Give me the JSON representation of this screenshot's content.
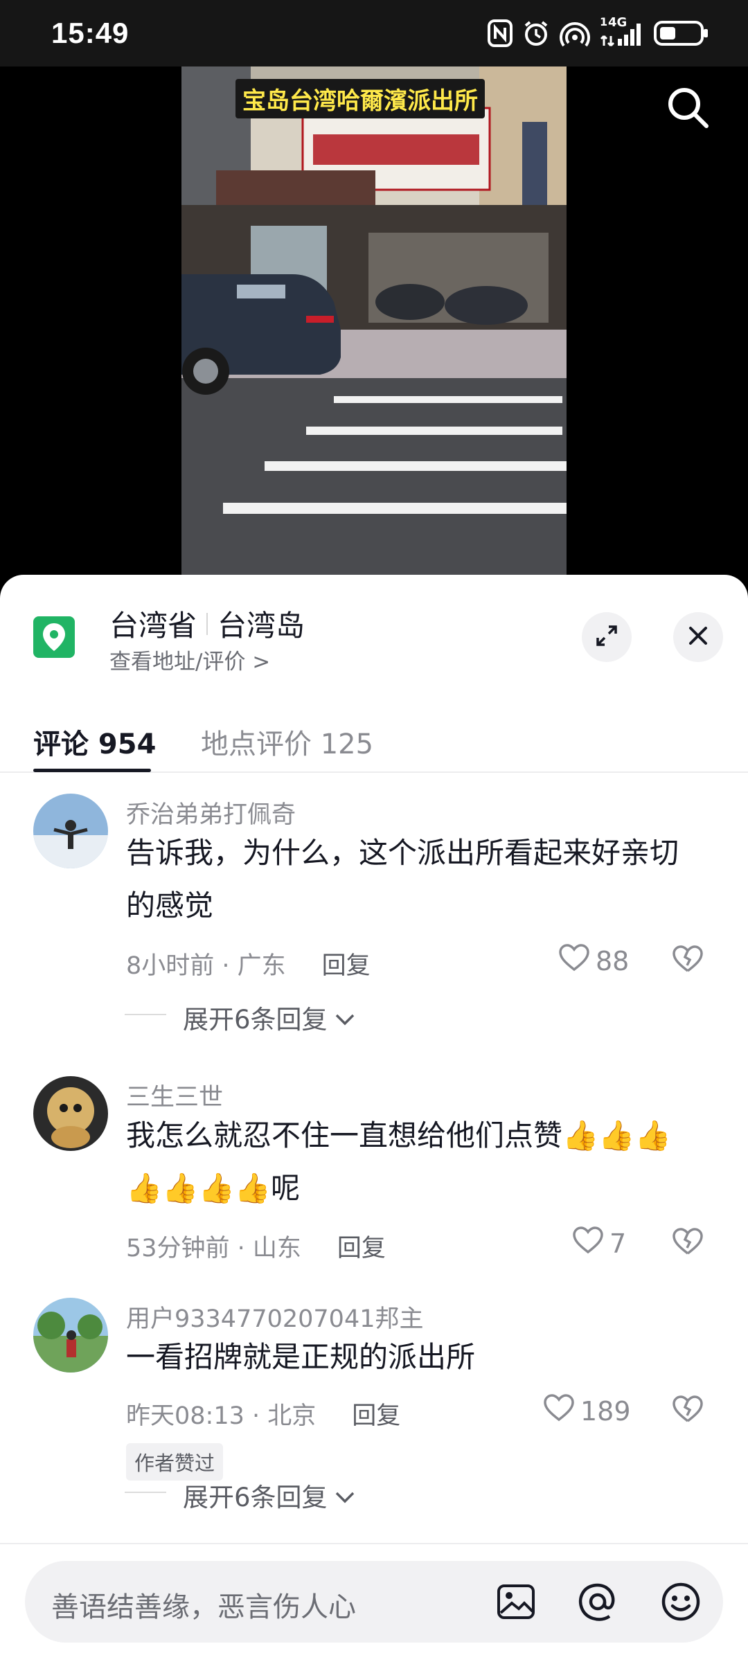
{
  "status_bar": {
    "time": "15:49",
    "network": "4G",
    "sim_slot": "1",
    "icons": [
      "nfc-icon",
      "alarm-icon",
      "hotspot-icon",
      "signal-icon",
      "battery-icon"
    ]
  },
  "video": {
    "caption": "宝岛台湾哈爾濱派出所",
    "icons": [
      "search-icon"
    ]
  },
  "location": {
    "province": "台湾省",
    "place": "台湾岛",
    "subtitle": "查看地址/评价 >",
    "icon_color": "#20b464",
    "icons": [
      "location-pin-icon",
      "expand-icon",
      "close-icon"
    ]
  },
  "tabs": [
    {
      "label": "评论 954",
      "active": true
    },
    {
      "label": "地点评价 125",
      "active": false
    }
  ],
  "comments": [
    {
      "user": "乔治弟弟打佩奇",
      "text": "告诉我，为什么，这个派出所看起来好亲切的感觉",
      "time_location": "8小时前 · 广东",
      "reply_label": "回复",
      "likes": "88",
      "expand_label": "展开6条回复"
    },
    {
      "user": "三生三世",
      "text": "我怎么就忍不住一直想给他们点赞👍👍👍👍👍👍👍呢",
      "time_location": "53分钟前 · 山东",
      "reply_label": "回复",
      "likes": "7"
    },
    {
      "user": "用户9334770207041邦主",
      "text": "一看招牌就是正规的派出所",
      "time_location": "昨天08:13 · 北京",
      "reply_label": "回复",
      "likes": "189",
      "badge": "作者赞过",
      "expand_label": "展开6条回复"
    }
  ],
  "input": {
    "placeholder": "善语结善缘，恶言伤人心",
    "icons": [
      "image-icon",
      "mention-icon",
      "emoji-icon"
    ]
  }
}
